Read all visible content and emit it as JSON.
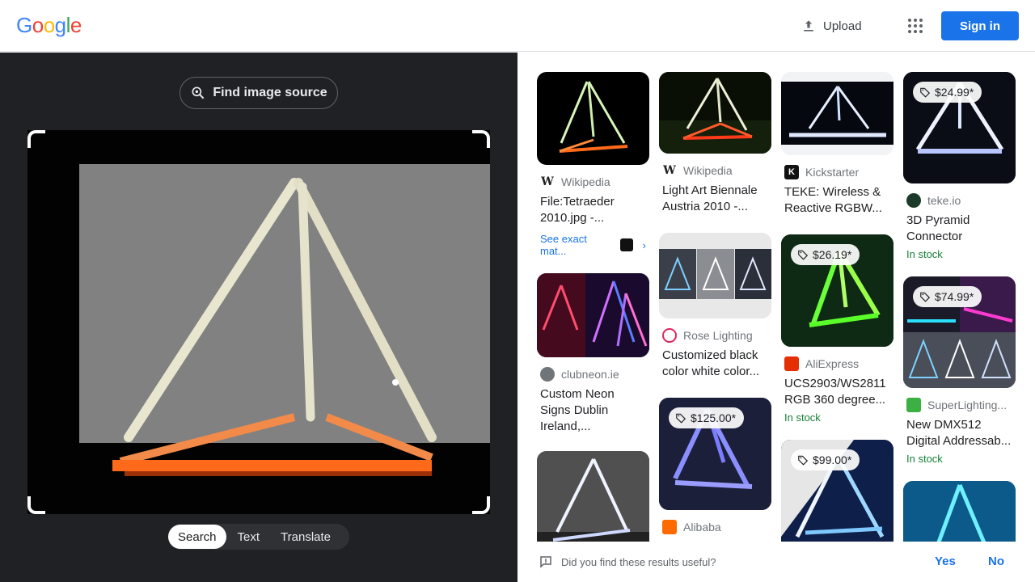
{
  "header": {
    "logo": [
      "G",
      "o",
      "o",
      "g",
      "l",
      "e"
    ],
    "logo_colors": [
      "#4285f4",
      "#ea4335",
      "#fbbc05",
      "#4285f4",
      "#34a853",
      "#ea4335"
    ],
    "upload_label": "Upload",
    "signin_label": "Sign in"
  },
  "lens": {
    "find_source_label": "Find image source",
    "modes": [
      "Search",
      "Text",
      "Translate"
    ],
    "active_mode": "Search"
  },
  "results": {
    "col1": [
      {
        "source": "Wikipedia",
        "title": "File:Tetraeder 2010.jpg -...",
        "exact_label": "See exact mat..."
      },
      {
        "source": "clubneon.ie",
        "title": "Custom Neon Signs Dublin Ireland,..."
      }
    ],
    "col2": [
      {
        "source": "Wikipedia",
        "title": "Light Art Biennale Austria 2010 -..."
      },
      {
        "source": "Rose Lighting",
        "title": "Customized black color white color..."
      },
      {
        "price": "$125.00*",
        "source": "Alibaba"
      }
    ],
    "col3": [
      {
        "source": "Kickstarter",
        "title": "TEKE: Wireless & Reactive RGBW..."
      },
      {
        "price": "$26.19*",
        "source": "AliExpress",
        "title": "UCS2903/WS2811 RGB 360 degree...",
        "stock": "In stock"
      },
      {
        "price": "$99.00*"
      }
    ],
    "col4": [
      {
        "price": "$24.99*",
        "source": "teke.io",
        "title": "3D Pyramid Connector",
        "stock": "In stock"
      },
      {
        "price": "$74.99*",
        "source": "SuperLighting...",
        "title": "New DMX512 Digital Addressab...",
        "stock": "In stock"
      }
    ]
  },
  "footer": {
    "question": "Did you find these results useful?",
    "yes": "Yes",
    "no": "No"
  }
}
